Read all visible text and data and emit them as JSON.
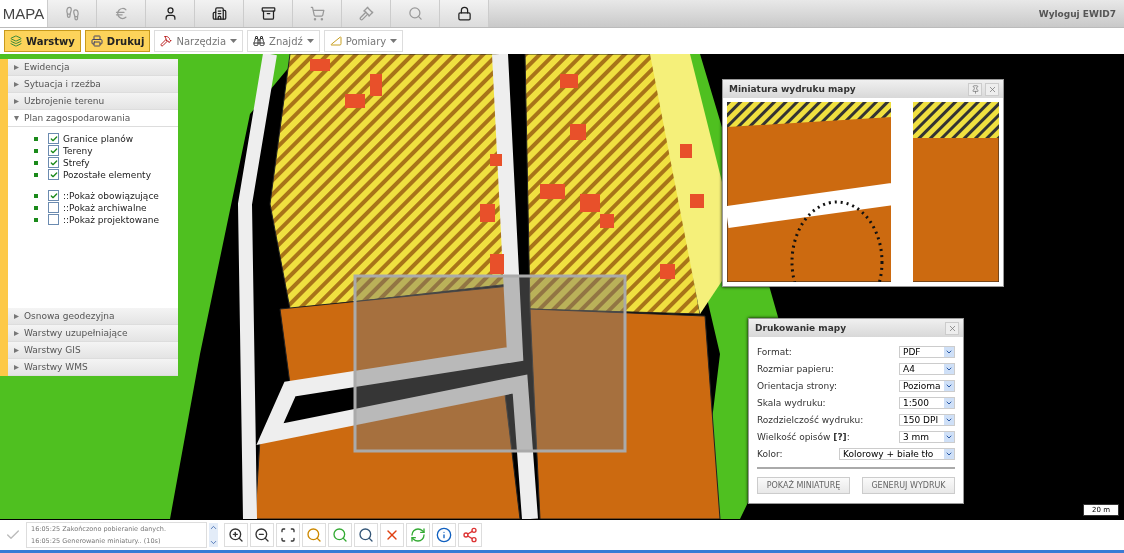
{
  "tabs": [
    {
      "label": "MAPA",
      "selected": true
    },
    {
      "selected": false
    },
    {
      "selected": false
    },
    {
      "selected": false
    },
    {
      "selected": false
    },
    {
      "selected": false
    },
    {
      "selected": false
    },
    {
      "selected": false
    },
    {
      "selected": false
    },
    {
      "selected": false
    }
  ],
  "logout": "Wyloguj EWID7",
  "toolbar": [
    {
      "label": "Warstwy",
      "active": true,
      "dropdown": false
    },
    {
      "label": "Drukuj",
      "active": true,
      "dropdown": false
    },
    {
      "label": "Narzędzia",
      "active": false,
      "dropdown": true
    },
    {
      "label": "Znajdź",
      "active": false,
      "dropdown": true
    },
    {
      "label": "Pomiary",
      "active": false,
      "dropdown": true
    }
  ],
  "sidebar": {
    "sections": [
      {
        "label": "Ewidencja",
        "expanded": false
      },
      {
        "label": "Sytuacja i rzeźba",
        "expanded": false
      },
      {
        "label": "Uzbrojenie terenu",
        "expanded": false
      },
      {
        "label": "Plan zagospodarowania",
        "expanded": true,
        "groups": [
          [
            {
              "label": "Granice planów",
              "checked": true
            },
            {
              "label": "Tereny",
              "checked": true
            },
            {
              "label": "Strefy",
              "checked": true
            },
            {
              "label": "Pozostałe elementy",
              "checked": true
            }
          ],
          [
            {
              "label": "::Pokaż obowiązujące",
              "checked": true
            },
            {
              "label": "::Pokaż archiwalne",
              "checked": false
            },
            {
              "label": "::Pokaż projektowane",
              "checked": false
            }
          ]
        ]
      },
      {
        "label": "Osnowa geodezyjna",
        "expanded": false
      },
      {
        "label": "Warstwy uzupełniające",
        "expanded": false
      },
      {
        "label": "Warstwy GIS",
        "expanded": false
      },
      {
        "label": "Warstwy WMS",
        "expanded": false
      }
    ]
  },
  "scale": "20 m",
  "miniature": {
    "title": "Miniatura wydruku mapy"
  },
  "print": {
    "title": "Drukowanie mapy",
    "fields": [
      {
        "label": "Format:",
        "value": "PDF",
        "wide": false
      },
      {
        "label": "Rozmiar papieru:",
        "value": "A4",
        "wide": false
      },
      {
        "label": "Orientacja strony:",
        "value": "Pozioma",
        "wide": false
      },
      {
        "label": "Skala wydruku:",
        "value": "1:500",
        "wide": false
      },
      {
        "label": "Rozdzielczość wydruku:",
        "value": "150 DPI",
        "wide": false
      },
      {
        "label": "Wielkość opisów **[?]**:",
        "value": "3 mm",
        "wide": false
      },
      {
        "label": "Kolor:",
        "value": "Kolorowy + białe tło",
        "wide": true
      }
    ],
    "buttons": [
      "POKAŻ MINIATURĘ",
      "GENERUJ WYDRUK"
    ]
  },
  "status": {
    "messages": [
      "16:05:25 Zakończono pobieranie danych.",
      "16:05:25 Generowanie miniatury.. (10s)"
    ]
  }
}
